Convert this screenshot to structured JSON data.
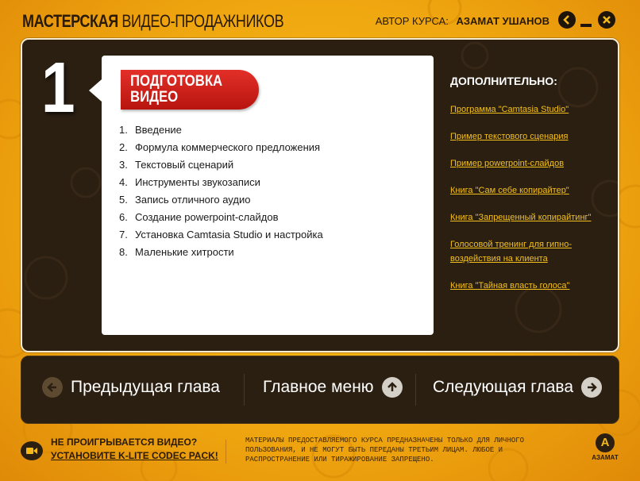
{
  "header": {
    "title_part1": "МАСТЕРСКАЯ",
    "title_part2": "ВИДЕО-ПРОДАЖНИКОВ",
    "author_label": "АВТОР КУРСА:",
    "author_name": "АЗАМАТ УШАНОВ"
  },
  "chapter": {
    "number": "1",
    "title_line1": "ПОДГОТОВКА",
    "title_line2": "ВИДЕО",
    "lessons": [
      {
        "num": "1.",
        "label": "Введение"
      },
      {
        "num": "2.",
        "label": "Формула коммерческого предложения"
      },
      {
        "num": "3.",
        "label": "Текстовый сценарий"
      },
      {
        "num": "4.",
        "label": "Инструменты звукозаписи"
      },
      {
        "num": "5.",
        "label": "Запись отличного аудио"
      },
      {
        "num": "6.",
        "label": "Создание powerpoint-слайдов"
      },
      {
        "num": "7.",
        "label": "Установка Camtasia Studio и настройка"
      },
      {
        "num": "8.",
        "label": "Маленькие хитрости"
      }
    ]
  },
  "extras": {
    "title": "ДОПОЛНИТЕЛЬНО:",
    "links": [
      "Программа \"Camtasia Studio\"",
      "Пример текстового сценария",
      "Пример powerpoint-слайдов",
      "Книга \"Сам себе копирайтер\"",
      "Книга \"Запрещенный копирайтинг\"",
      "Голосовой тренинг для гипно-воздействия на клиента",
      "Книга \"Тайная власть голоса\""
    ]
  },
  "nav": {
    "prev_label": "Предыдущая глава",
    "main_label": "Главное меню",
    "next_label": "Следующая глава"
  },
  "footer": {
    "question": "НЕ ПРОИГРЫВАЕТСЯ ВИДЕО?",
    "link": "УСТАНОВИТЕ K-LITE CODEC PACK!",
    "copyright": "МАТЕРИАЛЫ ПРЕДОСТАВЛЯЕМОГО КУРСА ПРЕДНАЗНАЧЕНЫ ТОЛЬКО ДЛЯ ЛИЧНОГО ПОЛЬЗОВАНИЯ, И НЕ МОГУТ БЫТЬ ПЕРЕДАНЫ ТРЕТЬИМ ЛИЦАМ. ЛЮБОЕ И РАСПРОСТРАНЕНИЕ ИЛИ ТИРАЖИРОВАНИЕ ЗАПРЕЩЕНО.",
    "brand": "АЗАМАТ"
  },
  "colors": {
    "background": "#f0a810",
    "panel": "#2b1f12",
    "accent_red": "#c8201a",
    "link_yellow": "#f4c01c"
  },
  "icons": {
    "back": "back-arrow-icon",
    "minimize": "minimize-icon",
    "close": "close-icon",
    "prev": "arrow-left-icon",
    "main": "arrow-up-icon",
    "next": "arrow-right-icon",
    "video": "video-camera-icon",
    "brand": "brand-logo-icon"
  }
}
